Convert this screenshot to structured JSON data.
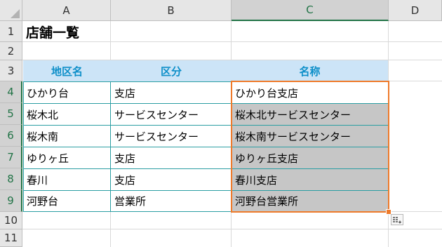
{
  "columns": [
    "A",
    "B",
    "C",
    "D"
  ],
  "rows": [
    "1",
    "2",
    "3",
    "4",
    "5",
    "6",
    "7",
    "8",
    "9",
    "10",
    "11"
  ],
  "selected_column": "C",
  "selected_rows": [
    "4",
    "5",
    "6",
    "7",
    "8",
    "9"
  ],
  "cells": {
    "A1": "店舗一覧",
    "A3": "地区名",
    "B3": "区分",
    "C3": "名称",
    "A4": "ひかり台",
    "B4": "支店",
    "C4": "ひかり台支店",
    "A5": "桜木北",
    "B5": "サービスセンター",
    "C5": "桜木北サービスセンター",
    "A6": "桜木南",
    "B6": "サービスセンター",
    "C6": "桜木南サービスセンター",
    "A7": "ゆりヶ丘",
    "B7": "支店",
    "C7": "ゆりヶ丘支店",
    "A8": "春川",
    "B8": "支店",
    "C8": "春川支店",
    "A9": "河野台",
    "B9": "営業所",
    "C9": "河野台営業所"
  },
  "colors": {
    "header_fill": "#cce4f7",
    "header_text": "#0e8fc9",
    "table_border": "#2b9ea3",
    "selection_border": "#ef7a2a",
    "selection_fill": "#c6c6c6",
    "excel_green": "#217346"
  },
  "icons": {
    "flash_fill_options": "flash-fill-options-icon"
  }
}
